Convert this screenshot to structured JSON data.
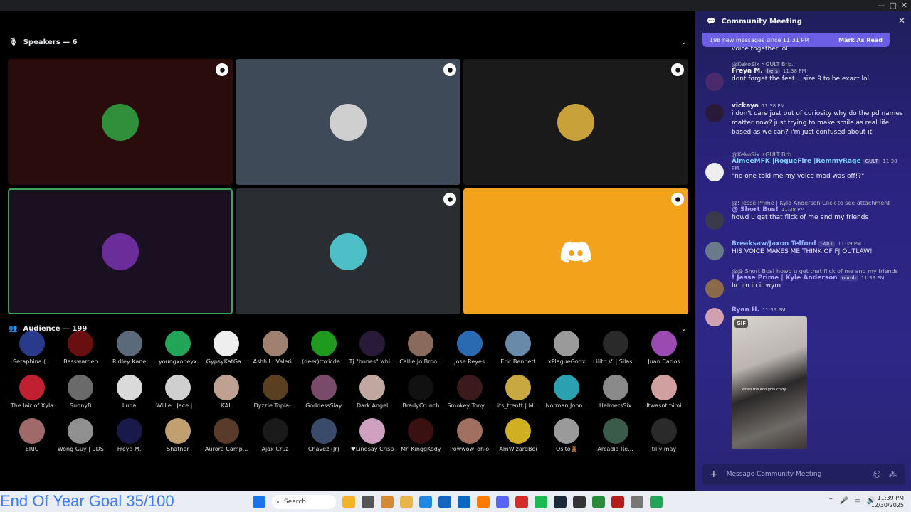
{
  "window": {
    "controls": [
      "—",
      "▢",
      "✕"
    ]
  },
  "speakers": {
    "label": "Speakers — 6",
    "tiles": [
      {
        "bg": "#2a0c0c",
        "avatar": "#2f8f3a"
      },
      {
        "bg": "#3e4a58",
        "avatar": "#cfcfcf"
      },
      {
        "bg": "#1a1a1a",
        "avatar": "#c9a13b"
      },
      {
        "bg": "#1a1022",
        "avatar": "#6b2d9a"
      },
      {
        "bg": "#2a2d31",
        "avatar": "#4fbfc7"
      },
      {
        "bg": "#f2a31b",
        "avatar": "discord"
      }
    ]
  },
  "audience": {
    "label": "Audience — 199",
    "members": [
      {
        "name": "Seraphina (...",
        "color": "#2a3a8a"
      },
      {
        "name": "Basswarden",
        "color": "#6a0f0f"
      },
      {
        "name": "Ridley Kane",
        "color": "#5a6a7a"
      },
      {
        "name": "youngxobeyx",
        "color": "#23a559"
      },
      {
        "name": "GypsyKatGa...",
        "color": "#eeeeee"
      },
      {
        "name": "Ashhil | Valeri...",
        "color": "#a08070"
      },
      {
        "name": "(deer)toxicde...",
        "color": "#1f9a1f"
      },
      {
        "name": "Tj \"bones\" whi...",
        "color": "#2a1a3a"
      },
      {
        "name": "Callie Jo Broo...",
        "color": "#8a6a5a"
      },
      {
        "name": "Jose Reyes",
        "color": "#2a6ab0"
      },
      {
        "name": "Eric Bennett",
        "color": "#6a8aaa"
      },
      {
        "name": "xPlagueGodx",
        "color": "#9a9a9a"
      },
      {
        "name": "Lilith V. | Silas...",
        "color": "#2a2a2a"
      },
      {
        "name": "Juan Carlos",
        "color": "#9a4ab0"
      },
      {
        "name": "The lair of Xyla",
        "color": "#c02030"
      },
      {
        "name": "SunnyB",
        "color": "#6a6a6a"
      },
      {
        "name": "Luna",
        "color": "#dadada"
      },
      {
        "name": "Willie | Jace | ...",
        "color": "#cfcfcf"
      },
      {
        "name": "KAL",
        "color": "#c0a090"
      },
      {
        "name": "Dyzzie Topia-...",
        "color": "#5a4020"
      },
      {
        "name": "GoddessSlay",
        "color": "#7a4a6a"
      },
      {
        "name": "Dark Angel",
        "color": "#c0a8a0"
      },
      {
        "name": "BradyCrunch",
        "color": "#111111"
      },
      {
        "name": "Smokey Tony ...",
        "color": "#3a1a1a"
      },
      {
        "name": "its_trentt | M...",
        "color": "#c8a840"
      },
      {
        "name": "Norman John...",
        "color": "#2aa0b0"
      },
      {
        "name": "HelmersSix",
        "color": "#8a8a8a"
      },
      {
        "name": "Itwasntmimi",
        "color": "#d0a0a0"
      },
      {
        "name": "ERIC",
        "color": "#a06a6a"
      },
      {
        "name": "Wong Guy | 9DS",
        "color": "#909090"
      },
      {
        "name": "Freya M.",
        "color": "#1a1a4a"
      },
      {
        "name": "Shatner",
        "color": "#c0a070"
      },
      {
        "name": "Aurora Camp...",
        "color": "#5a3a2a"
      },
      {
        "name": "Ajax Cruz",
        "color": "#1a1a1a"
      },
      {
        "name": "Chavez (Jr)",
        "color": "#3a4a6a"
      },
      {
        "name": "♥Lindsay Crisp",
        "color": "#d0a0c0"
      },
      {
        "name": "Mr_KinggKody",
        "color": "#3a1010"
      },
      {
        "name": "Powwow_ohio",
        "color": "#a07060"
      },
      {
        "name": "AmWizardBoi",
        "color": "#d0b020"
      },
      {
        "name": "Osito🧸",
        "color": "#9a9a9a"
      },
      {
        "name": "Arcadia Re...",
        "color": "#3a5a4a"
      },
      {
        "name": "tilly may",
        "color": "#2a2a2a"
      }
    ]
  },
  "panel": {
    "title": "Community Meeting",
    "new_messages": "198 new messages since 11:31 PM",
    "mark_read": "Mark As Read",
    "partial_top": "voice together lol",
    "messages": [
      {
        "reply": "@KekoSix ⚡GULT Brb..",
        "author": "Freya M.",
        "author_color": "#f2f3f5",
        "tag": "hers",
        "time": "11:38 PM",
        "text": "dont forget the feet... size 9 to be exact lol",
        "avatar": "#4a2a6a"
      },
      {
        "reply": "",
        "author": "vickaya",
        "author_color": "#f2f3f5",
        "tag": "",
        "time": "11:38 PM",
        "text": "i don't care just out of curiosity why do the pd names matter now? just trying to make smile as real life based as we can? i'm just confused about it",
        "avatar": "#2a1a3a"
      },
      {
        "reply": "@KekoSix ⚡GULT Brb..",
        "author": "AimeeMFK |RogueFire |RemmyRage",
        "author_color": "#7fd6ff",
        "tag": "GULT",
        "time": "11:38 PM",
        "text": "\"no one told me my voice mod was off!?\"",
        "avatar": "#eeeeee"
      },
      {
        "reply": "@! Jesse Prime | Kyle Anderson  Click to see attachment",
        "author": "@ Short Bus!",
        "author_color": "#b5a8ff",
        "tag": "",
        "time": "11:38 PM",
        "text": "howd u get that flick of me and my friends",
        "avatar": "#3a3a4a"
      },
      {
        "reply": "",
        "author": "Breaksaw/Jaxon Telford",
        "author_color": "#8fb8ff",
        "tag": "GULT",
        "time": "11:39 PM",
        "text": "HIS VOICE MAKES ME THINK OF FJ OUTLAW!",
        "avatar": "#6a7a8a"
      },
      {
        "reply": "@@ Short Bus! howd u get that flick of me and my friends",
        "author": "! Jesse Prime | Kyle Anderson",
        "author_color": "#b5a8ff",
        "tag": "numb",
        "time": "11:39 PM",
        "text": "bc im in it wym",
        "avatar": "#8a6a4a"
      },
      {
        "reply": "",
        "author": "Ryan H.",
        "author_color": "#b5a8ff",
        "tag": "",
        "time": "11:39 PM",
        "text": "",
        "avatar": "#d0a0b0"
      }
    ],
    "gif_badge": "GIF",
    "gif_caption": "When the edo goin crazy",
    "input_placeholder": "Message Community Meeting"
  },
  "taskbar": {
    "goal_text": "End Of Year Goal 35/100",
    "search_label": "Search",
    "time": "11:39 PM",
    "date": "12/30/2025",
    "app_colors": [
      "#f0b429",
      "#555555",
      "#d08a3a",
      "#e8b54a",
      "#1e88e5",
      "#1565c0",
      "#0a66c2",
      "#ff7a00",
      "#5865f2",
      "#d62b2b",
      "#1db954",
      "#1b2838",
      "#333333",
      "#2a8a3a",
      "#b71c1c",
      "#777777",
      "#23a559"
    ]
  }
}
